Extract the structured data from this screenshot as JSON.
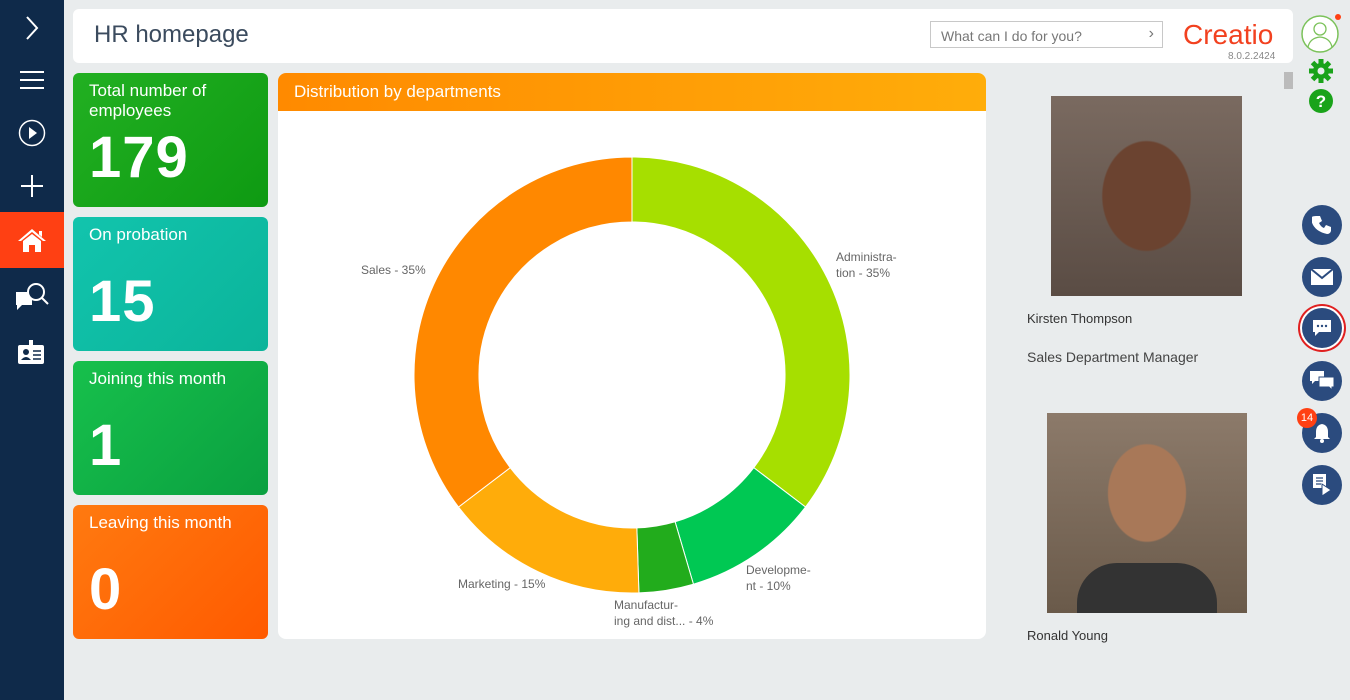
{
  "header": {
    "title": "HR homepage",
    "search_placeholder": "What can I do for you?",
    "logo": "Creatio",
    "version": "8.0.2.2424"
  },
  "sidebar": {
    "items": [
      {
        "icon": "chevron-right-icon"
      },
      {
        "icon": "menu-icon"
      },
      {
        "icon": "play-icon"
      },
      {
        "icon": "plus-icon"
      },
      {
        "icon": "home-icon",
        "active": true
      },
      {
        "icon": "search-feedback-icon"
      },
      {
        "icon": "id-card-icon"
      }
    ]
  },
  "tiles": [
    {
      "label": "Total number of employees",
      "value": "179",
      "color": "#1aa31a"
    },
    {
      "label": "On probation",
      "value": "15",
      "color": "#10bfa5"
    },
    {
      "label": "Joining this month",
      "value": "1",
      "color": "#14b84a"
    },
    {
      "label": "Leaving this month",
      "value": "0",
      "color": "#ff6a00"
    }
  ],
  "chart_data": {
    "type": "pie",
    "title": "Distribution by departments",
    "donut": true,
    "categories": [
      "Administration",
      "Development",
      "Manufacturing and dist...",
      "Marketing",
      "Sales"
    ],
    "values": [
      35,
      10,
      4,
      15,
      35
    ],
    "labels": [
      "Administra-\ntion - 35%",
      "Developme-\nnt - 10%",
      "Manufactur-\ning and dist... - 4%",
      "Marketing - 15%",
      "Sales - 35%"
    ],
    "colors": [
      "#a6df00",
      "#00c853",
      "#22ac1c",
      "#ffac0a",
      "#ff8800"
    ]
  },
  "people": [
    {
      "name": "Kirsten Thompson",
      "role": "Sales Department Manager"
    },
    {
      "name": "Ronald Young"
    }
  ],
  "right_bar": {
    "notification_count": "14"
  }
}
